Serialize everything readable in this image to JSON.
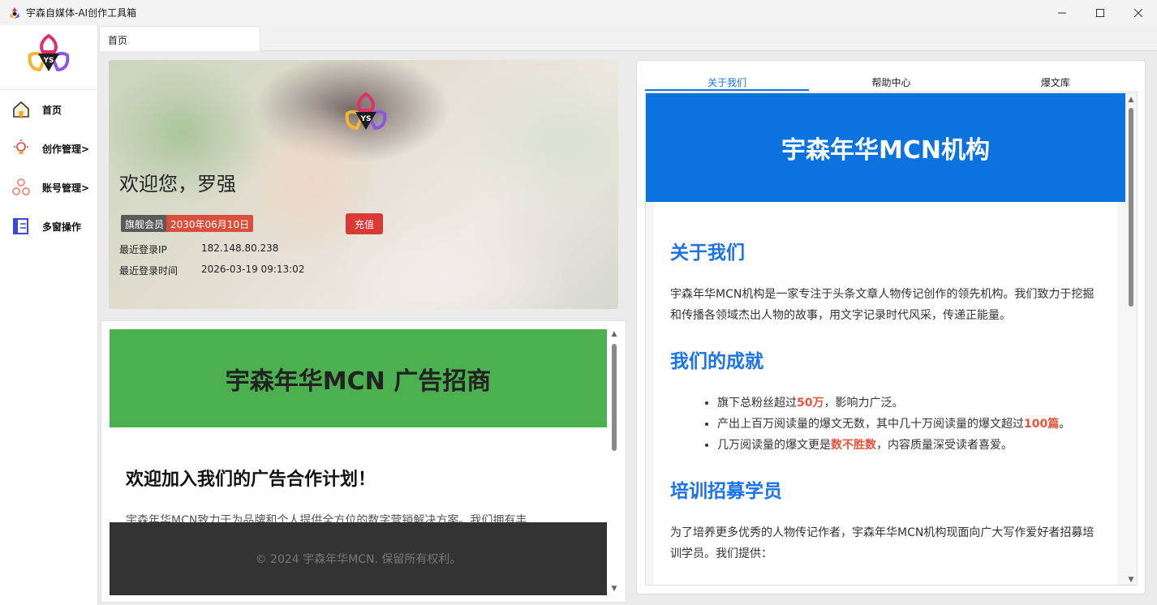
{
  "window": {
    "title": "宇森自媒体-AI创作工具箱",
    "controls": [
      "—",
      "☐",
      "✕"
    ]
  },
  "sidebar": {
    "items": [
      {
        "label": "首页",
        "icon": "home-icon"
      },
      {
        "label": "创作管理>",
        "icon": "lightbulb-icon"
      },
      {
        "label": "账号管理>",
        "icon": "network-icon"
      },
      {
        "label": "多窗操作",
        "icon": "window-list-icon"
      }
    ]
  },
  "tabs": {
    "home": "首页"
  },
  "welcome": {
    "greeting": "欢迎您，罗强",
    "member_level": "旗舰会员",
    "expire_date": "2030年06月10日",
    "recharge_label": "充值",
    "last_ip_label": "最近登录IP",
    "last_ip": "182.148.80.238",
    "last_time_label": "最近登录时间",
    "last_time": "2026-03-19 09:13:02"
  },
  "ad": {
    "header": "宇森年华MCN 广告招商",
    "heading": "欢迎加入我们的广告合作计划！",
    "paragraph": "宇森年华MCN致力于为品牌和个人提供全方位的数字营销解决方案。我们拥有丰",
    "footer": "© 2024 宇森年华MCN. 保留所有权利。"
  },
  "right": {
    "tabs": [
      "关于我们",
      "帮助中心",
      "爆文库"
    ],
    "hero": "宇森年华MCN机构",
    "about_title": "关于我们",
    "about_text": "宇森年华MCN机构是一家专注于头条文章人物传记创作的领先机构。我们致力于挖掘和传播各领域杰出人物的故事，用文字记录时代风采，传递正能量。",
    "achieve_title": "我们的成就",
    "achieve_1a": "旗下总粉丝超过",
    "achieve_1b": "50万",
    "achieve_1c": "，影响力广泛。",
    "achieve_2a": "产出上百万阅读量的爆文无数，其中几十万阅读量的爆文超过",
    "achieve_2b": "100篇",
    "achieve_2c": "。",
    "achieve_3a": "几万阅读量的爆文更是",
    "achieve_3b": "数不胜数",
    "achieve_3c": "，内容质量深受读者喜爱。",
    "train_title": "培训招募学员",
    "train_text": "为了培养更多优秀的人物传记作者，宇森年华MCN机构现面向广大写作爱好者招募培训学员。我们提供："
  },
  "colors": {
    "accent": "#1a73e8",
    "ad_green": "#4caf50",
    "hero_blue": "#0a73e0",
    "highlight": "#e8533a",
    "recharge_red": "#d93a38"
  }
}
